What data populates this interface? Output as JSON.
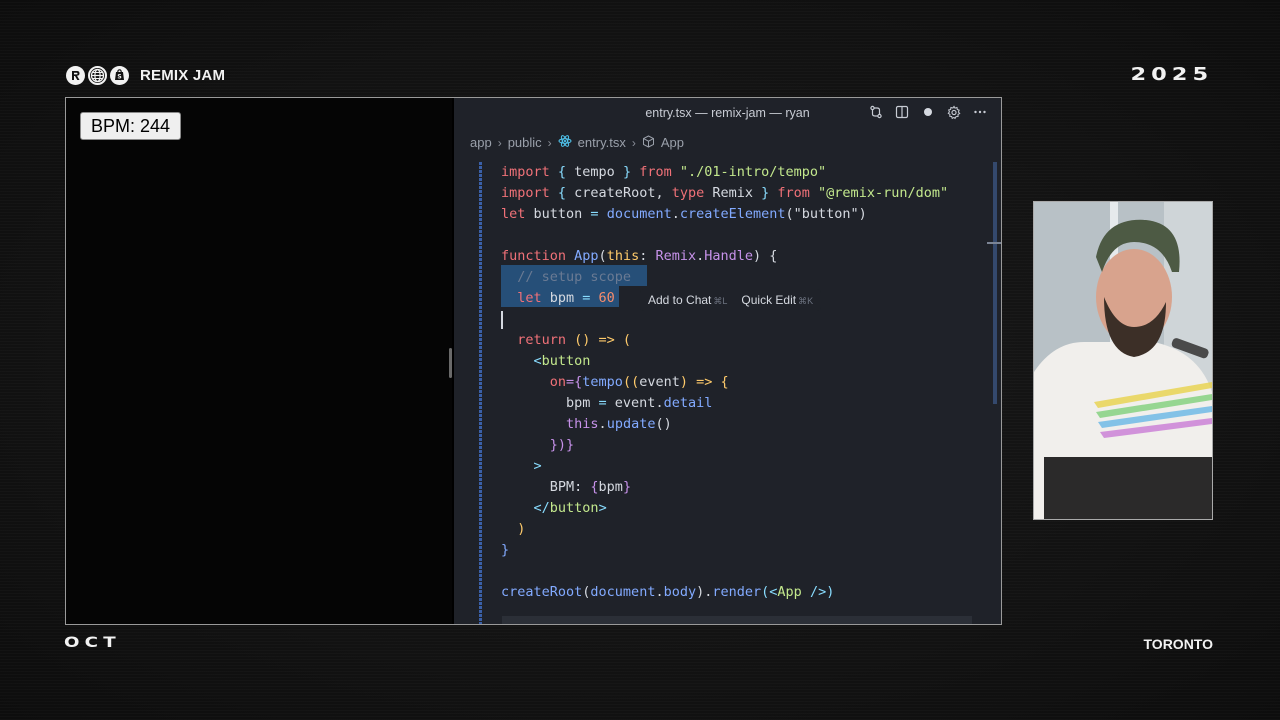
{
  "event": {
    "brand_name": "REMIX JAM",
    "year": "2025",
    "month": "OCT",
    "city": "TORONTO"
  },
  "preview": {
    "button_label": "BPM: 244"
  },
  "editor": {
    "title": "entry.tsx — remix-jam — ryan",
    "breadcrumb": [
      "app",
      "public",
      "entry.tsx",
      "App"
    ],
    "inline_actions": {
      "add_to_chat": "Add to Chat",
      "add_to_chat_shortcut": "⌘L",
      "quick_edit": "Quick Edit",
      "quick_edit_shortcut": "⌘K"
    },
    "code": {
      "l1": {
        "a": "import",
        "b": " { ",
        "c": "tempo",
        "d": " } ",
        "e": "from",
        "f": " \"./01-intro/tempo\""
      },
      "l2": {
        "a": "import",
        "b": " { ",
        "c": "createRoot",
        "d": ", ",
        "e": "type",
        "f": " Remix",
        "g": " } ",
        "h": "from",
        "i": " \"@remix-run/dom\""
      },
      "l3": {
        "a": "let",
        "b": " button ",
        "c": "=",
        "d": " document",
        "e": ".",
        "f": "createElement",
        "g": "(\"button\")"
      },
      "l5": {
        "a": "function",
        "b": " App",
        "c": "(",
        "d": "this",
        "e": ": ",
        "f": "Remix",
        "g": ".",
        "h": "Handle",
        "i": ") {"
      },
      "l6": "  // setup scope",
      "l7": {
        "a": "  let",
        "b": " bpm ",
        "c": "=",
        "d": " 60"
      },
      "l9": {
        "a": "  return",
        "b": " () => ("
      },
      "l10": {
        "a": "    <",
        "b": "button"
      },
      "l11": {
        "a": "      on",
        "b": "={",
        "c": "tempo",
        "d": "((",
        "e": "event",
        "f": ") => {"
      },
      "l12": {
        "a": "        bpm",
        "b": " = ",
        "c": "event",
        "d": ".",
        "e": "detail"
      },
      "l13": {
        "a": "        this",
        "b": ".",
        "c": "update",
        "d": "()"
      },
      "l14": "      })}",
      "l15": "    >",
      "l16": {
        "a": "      BPM: ",
        "b": "{",
        "c": "bpm",
        "d": "}"
      },
      "l17": {
        "a": "    </",
        "b": "button",
        "c": ">"
      },
      "l18": "  )",
      "l19": "}",
      "l21": {
        "a": "createRoot",
        "b": "(",
        "c": "document",
        "d": ".",
        "e": "body",
        "f": ").",
        "g": "render",
        "h": "(<",
        "i": "App",
        "j": " />)"
      }
    }
  },
  "icons": {
    "brand": [
      "remix-logo-icon",
      "globe-icon",
      "shopify-icon"
    ],
    "titlebar": [
      "compare-icon",
      "split-editor-icon",
      "unsaved-dot-icon",
      "settings-gear-icon",
      "more-icon"
    ]
  },
  "colors": {
    "editor_bg": "#1f2229",
    "keyword": "#f07178",
    "string": "#c3e88d",
    "function": "#82aaff",
    "selection": "#264f78"
  }
}
